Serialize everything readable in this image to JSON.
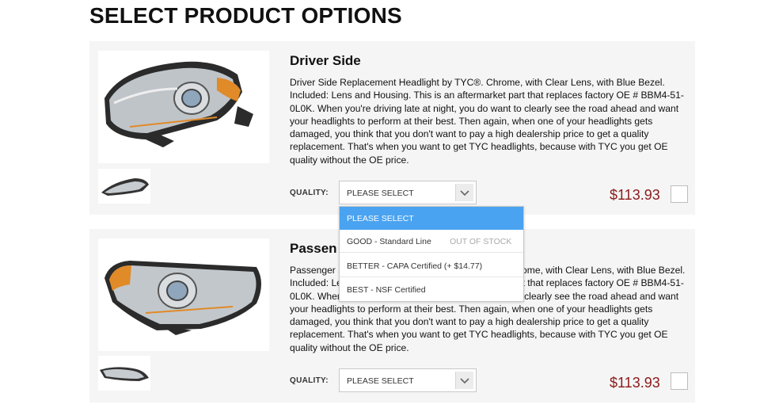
{
  "page": {
    "title": "SELECT PRODUCT OPTIONS"
  },
  "products": [
    {
      "name": "Driver Side",
      "description": "Driver Side Replacement Headlight by TYC®. Chrome, with Clear Lens, with Blue Bezel. Included: Lens and Housing. This is an aftermarket part that replaces factory OE # BBM4-51-0L0K. When you're driving late at night, you do want to clearly see the road ahead and want your headlights to perform at their best. Then again, when one of your headlights gets damaged, you think that you don't want to pay a high dealership price to get a quality replacement. That's when you want to get TYC headlights, because with TYC you get OE quality without the OE price.",
      "quality_label": "QUALITY:",
      "select_value": "PLEASE SELECT",
      "price": "$113.93"
    },
    {
      "name": "Passen",
      "description": "Passenger Side Replacement Headlight by TYC®. Chrome, with Clear Lens, with Blue Bezel. Included: Lens and Housing. This is an aftermarket part that replaces factory OE # BBM4-51-0L0K. When you're driving late at night, you do want to clearly see the road ahead and want your headlights to perform at their best. Then again, when one of your headlights gets damaged, you think that you don't want to pay a high dealership price to get a quality replacement. That's when you want to get TYC headlights, because with TYC you get OE quality without the OE price.",
      "quality_label": "QUALITY:",
      "select_value": "PLEASE SELECT",
      "price": "$113.93"
    }
  ],
  "dropdown": {
    "options": [
      {
        "label": "PLEASE SELECT",
        "status": ""
      },
      {
        "label": "GOOD - Standard Line",
        "status": "OUT OF STOCK"
      },
      {
        "label": "BETTER - CAPA Certified (+ $14.77)",
        "status": ""
      },
      {
        "label": "BEST - NSF Certified",
        "status": ""
      }
    ],
    "highlight_color": "#4aa3f0"
  },
  "colors": {
    "price": "#8b1a1a",
    "card_bg": "#f5f5f5"
  }
}
